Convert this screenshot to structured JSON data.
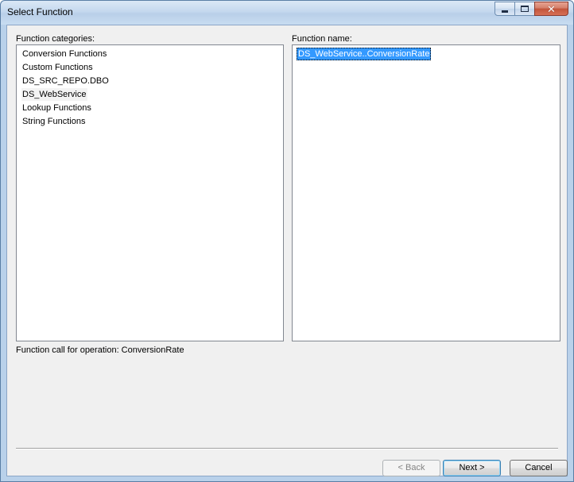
{
  "window": {
    "title": "Select Function"
  },
  "categories": {
    "label": "Function categories:",
    "items": [
      "Conversion Functions",
      "Custom Functions",
      "DS_SRC_REPO.DBO",
      "DS_WebService",
      "Lookup Functions",
      "String Functions"
    ],
    "highlighted_index": 3
  },
  "functions": {
    "label": "Function name:",
    "items": [
      "DS_WebService..ConversionRate"
    ],
    "selected_index": 0
  },
  "description": "Function call for operation: ConversionRate",
  "buttons": {
    "back": "< Back",
    "next": "Next >",
    "cancel": "Cancel"
  },
  "colors": {
    "selection": "#3399ff",
    "dialog_background": "#f0f0f0",
    "frame": "#b9d1ea"
  },
  "icons": [
    "minimize-icon",
    "maximize-icon",
    "close-icon"
  ]
}
